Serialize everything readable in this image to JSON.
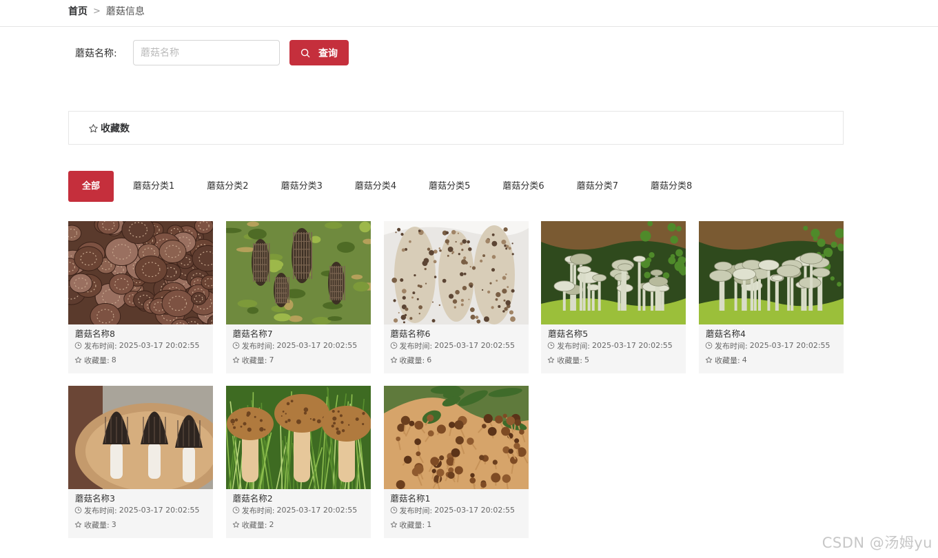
{
  "breadcrumb": {
    "home": "首页",
    "separator": ">",
    "current": "蘑菇信息"
  },
  "search": {
    "label": "蘑菇名称:",
    "placeholder": "蘑菇名称",
    "value": "",
    "button_label": "查询"
  },
  "sort": {
    "label": "收藏数"
  },
  "tabs": [
    "全部",
    "蘑菇分类1",
    "蘑菇分类2",
    "蘑菇分类3",
    "蘑菇分类4",
    "蘑菇分类5",
    "蘑菇分类6",
    "蘑菇分类7",
    "蘑菇分类8"
  ],
  "active_tab": "全部",
  "colors": {
    "accent": "#c52f3c",
    "card_bg": "#f5f5f5"
  },
  "card_labels": {
    "time_prefix": "发布时间:",
    "fav_prefix": "收藏量:"
  },
  "items": [
    {
      "name": "蘑菇名称8",
      "time": "2025-03-17 20:02:55",
      "favorites": "8",
      "image": "shiitake-pile"
    },
    {
      "name": "蘑菇名称7",
      "time": "2025-03-17 20:02:55",
      "favorites": "7",
      "image": "morel-forest"
    },
    {
      "name": "蘑菇名称6",
      "time": "2025-03-17 20:02:55",
      "favorites": "6",
      "image": "matsutake"
    },
    {
      "name": "蘑菇名称5",
      "time": "2025-03-17 20:02:55",
      "favorites": "5",
      "image": "oyster-cluster"
    },
    {
      "name": "蘑菇名称4",
      "time": "2025-03-17 20:02:55",
      "favorites": "4",
      "image": "oyster-cluster"
    },
    {
      "name": "蘑菇名称3",
      "time": "2025-03-17 20:02:55",
      "favorites": "3",
      "image": "morel-plate"
    },
    {
      "name": "蘑菇名称2",
      "time": "2025-03-17 20:02:55",
      "favorites": "2",
      "image": "bolete-grass"
    },
    {
      "name": "蘑菇名称1",
      "time": "2025-03-17 20:02:55",
      "favorites": "1",
      "image": "tea-tree"
    }
  ],
  "watermark": "CSDN @汤姆yu"
}
